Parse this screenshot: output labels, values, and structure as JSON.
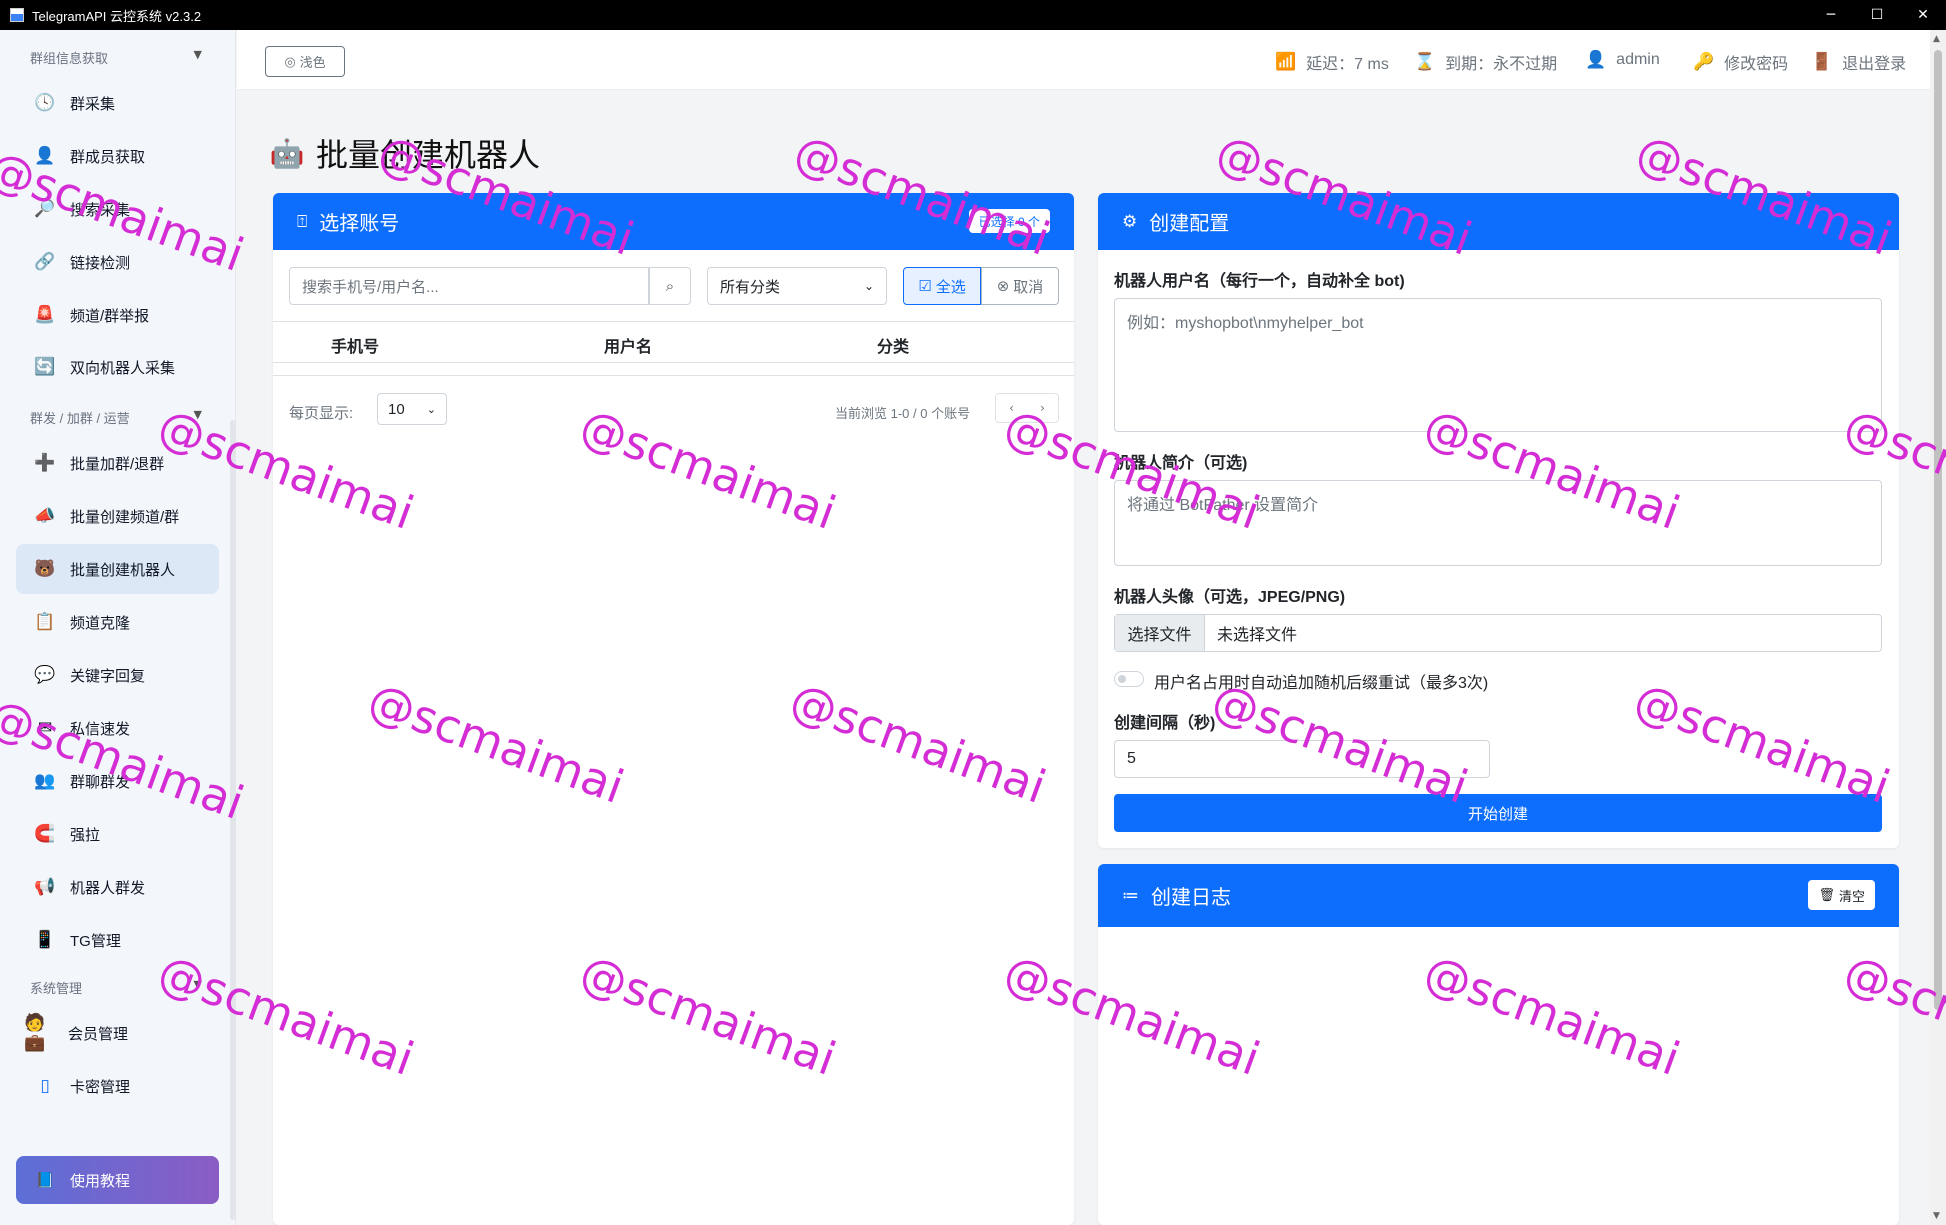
{
  "window": {
    "title": "TelegramAPI 云控系统 v2.3.2",
    "controls": [
      "─",
      "☐",
      "✕"
    ]
  },
  "sidebar": {
    "sections": [
      {
        "label": "群组信息获取",
        "chevron": "▼"
      },
      {
        "label": "群发 / 加群 / 运营",
        "chevron": "▼"
      },
      {
        "label": "系统管理",
        "chevron": "▼"
      }
    ],
    "items": [
      {
        "label": "群采集",
        "icon": "clock-icon",
        "glyph": "🕓"
      },
      {
        "label": "群成员获取",
        "icon": "user-icon",
        "glyph": "👤"
      },
      {
        "label": "搜索采集",
        "icon": "magnifier-icon",
        "glyph": "🔎"
      },
      {
        "label": "链接检测",
        "icon": "link-icon",
        "glyph": "🔗"
      },
      {
        "label": "频道/群举报",
        "icon": "alarm-icon",
        "glyph": "🚨"
      },
      {
        "label": "双向机器人采集",
        "icon": "sync-icon",
        "glyph": "🔄"
      },
      {
        "label": "批量加群/退群",
        "icon": "plus-icon",
        "glyph": "➕"
      },
      {
        "label": "批量创建频道/群",
        "icon": "megaphone-icon",
        "glyph": "📣"
      },
      {
        "label": "批量创建机器人",
        "icon": "robot-face-icon",
        "glyph": "🐻"
      },
      {
        "label": "频道克隆",
        "icon": "clipboard-icon",
        "glyph": "📋"
      },
      {
        "label": "关键字回复",
        "icon": "chat-icon",
        "glyph": "💬"
      },
      {
        "label": "私信速发",
        "icon": "message-icon",
        "glyph": "✉"
      },
      {
        "label": "群聊群发",
        "icon": "group-icon",
        "glyph": "👥"
      },
      {
        "label": "强拉",
        "icon": "magnet-icon",
        "glyph": "🧲"
      },
      {
        "label": "机器人群发",
        "icon": "loudspeaker-icon",
        "glyph": "📢"
      },
      {
        "label": "TG管理",
        "icon": "phone-icon",
        "glyph": "📱"
      },
      {
        "label": "会员管理",
        "icon": "members-icon",
        "glyph": "🧑💼"
      },
      {
        "label": "卡密管理",
        "icon": "card-icon",
        "glyph": "▯"
      }
    ],
    "tutorial": {
      "label": "使用教程",
      "glyph": "📘"
    }
  },
  "topbar": {
    "theme_button": "浅色",
    "theme_glyph": "◎",
    "latency": "延迟：7 ms",
    "expiry": "到期：永不过期",
    "user": "admin",
    "change_password": "修改密码",
    "logout": "退出登录"
  },
  "page": {
    "title": "批量创建机器人",
    "title_glyph": "🤖"
  },
  "accounts_card": {
    "title": "选择账号",
    "title_glyph": "⍐",
    "selected_badge": "已选择 0 个",
    "search_placeholder": "搜索手机号/用户名...",
    "category_selected": "所有分类",
    "select_all": "全选",
    "cancel": "取消",
    "columns": [
      "手机号",
      "用户名",
      "分类"
    ],
    "page_size_label": "每页显示:",
    "page_size": "10",
    "browse_info": "当前浏览 1-0 / 0 个账号",
    "pager": [
      "‹",
      "›"
    ]
  },
  "config_card": {
    "title": "创建配置",
    "title_glyph": "⚙",
    "username_label": "机器人用户名（每行一个，自动补全 bot)",
    "username_placeholder": "例如：myshopbot\\nmyhelper_bot",
    "about_label": "机器人简介（可选)",
    "about_placeholder": "将通过 BotFather 设置简介",
    "avatar_label": "机器人头像（可选，JPEG/PNG)",
    "file_button": "选择文件",
    "file_name": "未选择文件",
    "retry_toggle_label": "用户名占用时自动追加随机后缀重试（最多3次)",
    "interval_label": "创建间隔（秒)",
    "interval_value": "5",
    "start_button": "开始创建"
  },
  "log_card": {
    "title": "创建日志",
    "title_glyph": "≔",
    "clear_button": "清空",
    "clear_glyph": "🗑"
  },
  "watermark": "@scmaimai",
  "colors": {
    "primary": "#0d6efd",
    "watermark": "#d52dd5",
    "sidebar_bg": "#f3f6fa",
    "active_item": "#dde8f6"
  }
}
